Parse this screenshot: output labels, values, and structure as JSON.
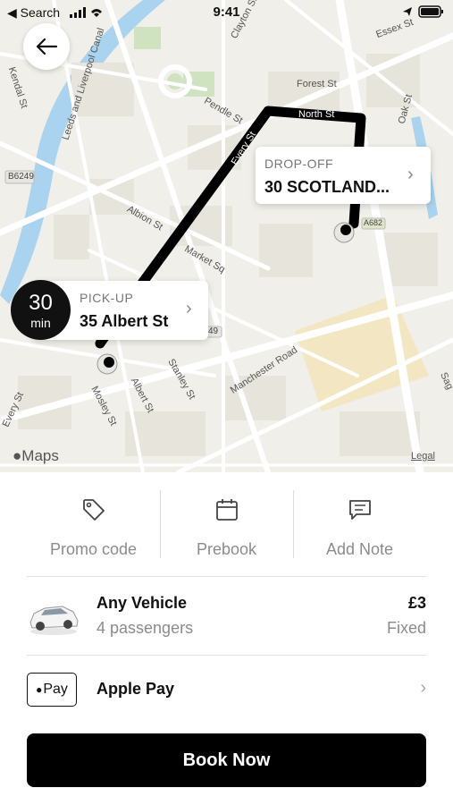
{
  "status_bar": {
    "back_app": "◀ Search",
    "time": "9:41"
  },
  "map": {
    "street_labels": [
      "Clayton St",
      "Essex St",
      "Forest St",
      "North St",
      "Pendle St",
      "Oak St",
      "Every St",
      "Albion St",
      "Market Sq",
      "Stanley St",
      "Manchester Road",
      "Mosley St",
      "Albert St",
      "Leeds and Liverpool Canal",
      "Kendal St",
      "B6249",
      "A682",
      "49",
      "Every St",
      "Sag"
    ],
    "eta": {
      "value": "30",
      "unit": "min"
    },
    "pickup": {
      "caption": "PICK-UP",
      "address": "35 Albert St"
    },
    "dropoff": {
      "caption": "DROP-OFF",
      "address": "30 SCOTLAND..."
    },
    "maps_attribution": "Maps",
    "legal_link": "Legal"
  },
  "actions": [
    {
      "label": "Promo code",
      "icon": "tag-icon"
    },
    {
      "label": "Prebook",
      "icon": "calendar-icon"
    },
    {
      "label": "Add Note",
      "icon": "message-icon"
    }
  ],
  "vehicle": {
    "name": "Any Vehicle",
    "passengers": "4 passengers",
    "price": "£3",
    "price_type": "Fixed",
    "icon": "car-icon"
  },
  "payment": {
    "badge": "Pay",
    "method": "Apple Pay"
  },
  "book_button": "Book Now",
  "colors": {
    "route": "#000000",
    "map_bg": "#f1efe9",
    "water": "#a9d3ee",
    "park": "#cfe3c0",
    "highlight_area": "#f3e3b0"
  }
}
